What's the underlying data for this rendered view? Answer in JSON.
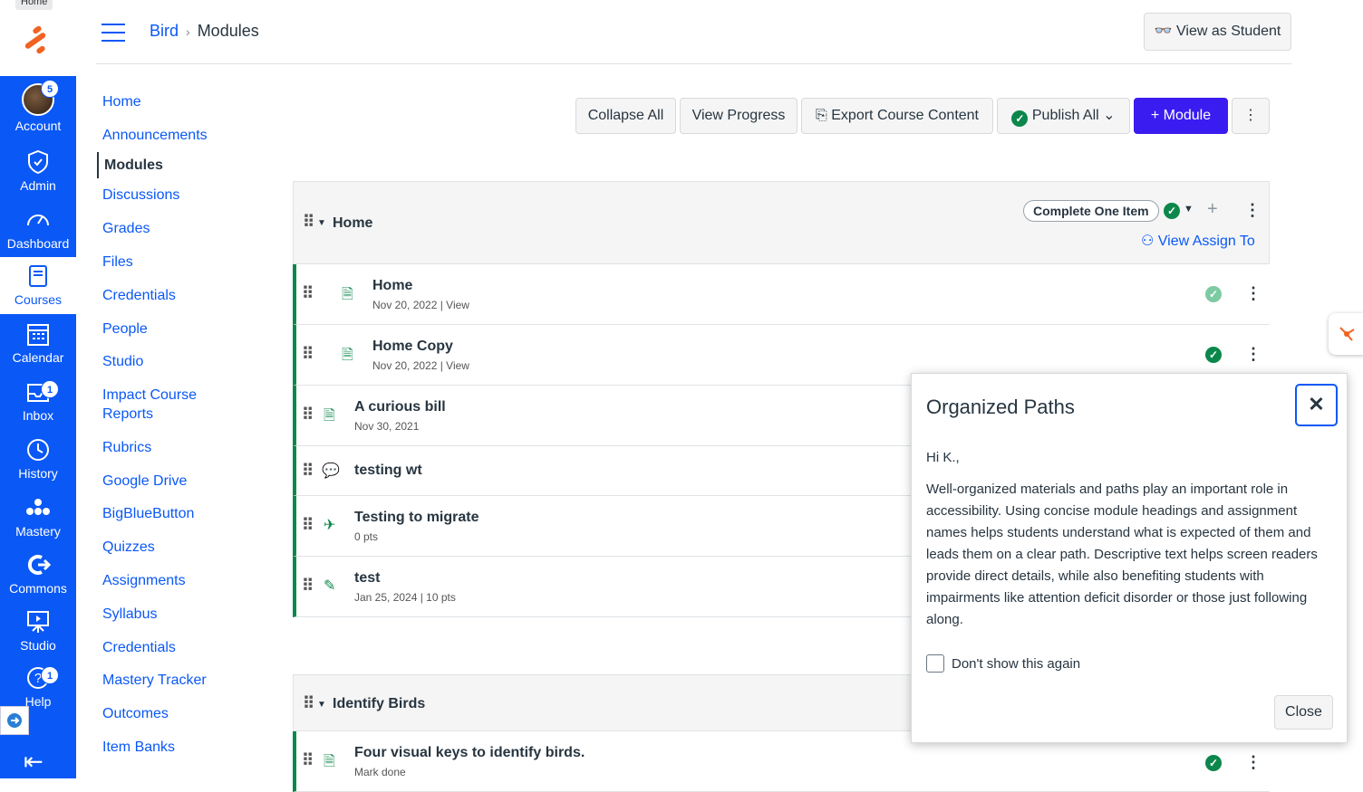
{
  "global_nav": {
    "home_tooltip": "Home",
    "account": {
      "label": "Account",
      "badge": "5"
    },
    "admin": {
      "label": "Admin"
    },
    "dashboard": {
      "label": "Dashboard"
    },
    "courses": {
      "label": "Courses"
    },
    "calendar": {
      "label": "Calendar"
    },
    "inbox": {
      "label": "Inbox",
      "badge": "1"
    },
    "history": {
      "label": "History"
    },
    "mastery": {
      "label": "Mastery"
    },
    "commons": {
      "label": "Commons"
    },
    "studio": {
      "label": "Studio"
    },
    "help": {
      "label": "Help",
      "badge": "1"
    },
    "brand_color": "#0a58f6"
  },
  "header": {
    "breadcrumb": {
      "course": "Bird",
      "page": "Modules"
    },
    "view_as_student": "View as Student"
  },
  "course_nav": {
    "items": [
      "Home",
      "Announcements",
      "Modules",
      "Discussions",
      "Grades",
      "Files",
      "Credentials",
      "People",
      "Studio",
      "Impact Course Reports",
      "Rubrics",
      "Google Drive",
      "BigBlueButton",
      "Quizzes",
      "Assignments",
      "Syllabus",
      "Credentials",
      "Mastery Tracker",
      "Outcomes",
      "Item Banks"
    ],
    "active": "Modules"
  },
  "toolbar": {
    "collapse_all": "Collapse All",
    "view_progress": "View Progress",
    "export": "Export Course Content",
    "publish_all": "Publish All",
    "add_module": "Module"
  },
  "modules": [
    {
      "title": "Home",
      "requirement": "Complete One Item",
      "assign_to": "View Assign To",
      "items": [
        {
          "title": "Home",
          "meta": "Nov 20, 2022  |  View"
        },
        {
          "title": "Home Copy",
          "meta": "Nov 20, 2022  |  View"
        },
        {
          "title": "A curious bill",
          "meta": "Nov 30, 2021"
        },
        {
          "title": "testing wt",
          "meta": ""
        },
        {
          "title": "Testing to migrate",
          "meta": "0 pts"
        },
        {
          "title": "test",
          "meta": "Jan 25, 2024  |  10 pts"
        }
      ]
    },
    {
      "title": "Identify Birds",
      "items": [
        {
          "title": "Four visual keys to identify birds.",
          "meta": "Mark done"
        }
      ]
    }
  ],
  "popup": {
    "title": "Organized Paths",
    "greeting": "Hi K.,",
    "body": "Well-organized materials and paths play an important role in accessibility. Using concise module headings and assignment names helps students understand what is expected of them and leads them on a clear path. Descriptive text helps screen readers provide direct details, while also benefiting students with impairments like attention deficit disorder or those just following along.",
    "checkbox_label": "Don't show this again",
    "close_button": "Close"
  }
}
